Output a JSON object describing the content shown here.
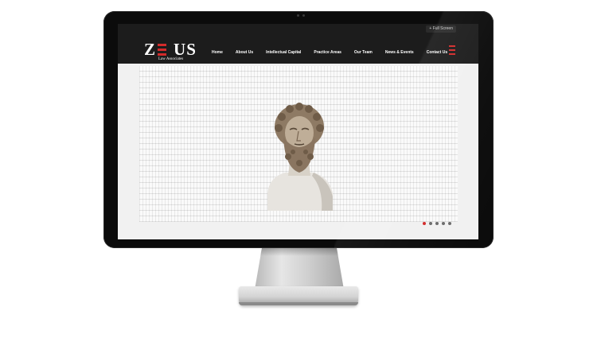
{
  "site": {
    "logo_text": "ZEUS",
    "logo_tagline": "Law Associates",
    "fullscreen_label": "+ Full Screen"
  },
  "nav": {
    "items": [
      {
        "label": "Home"
      },
      {
        "label": "About Us"
      },
      {
        "label": "Intellectual Capital"
      },
      {
        "label": "Practice Areas"
      },
      {
        "label": "Our Team"
      },
      {
        "label": "News & Events"
      },
      {
        "label": "Contact Us"
      }
    ]
  },
  "hero": {
    "image": "zeus-bust-statue",
    "slide_count": 5,
    "active_slide": 1
  },
  "colors": {
    "accent": "#d22b2b",
    "header_bg": "#1c1c1c"
  },
  "icons": [
    "menu-icon",
    "zeus-bust-image"
  ]
}
